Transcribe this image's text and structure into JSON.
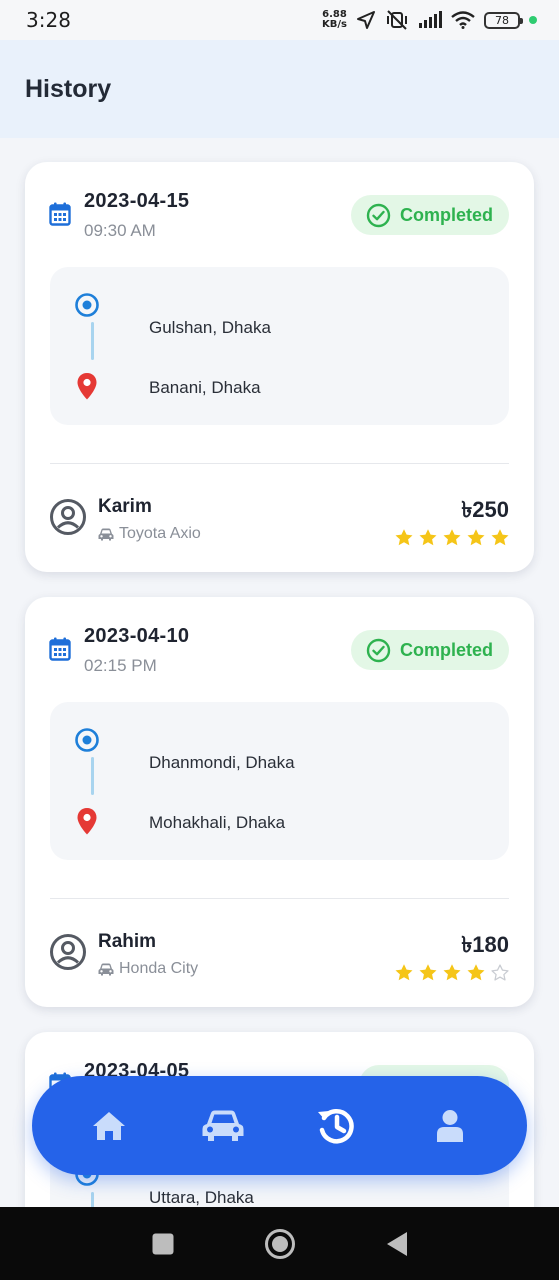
{
  "status_bar": {
    "time": "3:28",
    "net_speed_value": "6.88",
    "net_speed_unit": "KB/s",
    "battery": "78",
    "accent_dot_color": "#2ecc71"
  },
  "header": {
    "title": "History"
  },
  "trips": [
    {
      "date": "2023-04-15",
      "time": "09:30 AM",
      "status": "Completed",
      "origin": "Gulshan, Dhaka",
      "destination": "Banani, Dhaka",
      "driver": "Karim",
      "car": "Toyota Axio",
      "fare": "৳250",
      "rating": 5
    },
    {
      "date": "2023-04-10",
      "time": "02:15 PM",
      "status": "Completed",
      "origin": "Dhanmondi, Dhaka",
      "destination": "Mohakhali, Dhaka",
      "driver": "Rahim",
      "car": "Honda City",
      "fare": "৳180",
      "rating": 4
    },
    {
      "date": "2023-04-05",
      "origin": "Uttara, Dhaka"
    }
  ],
  "bottom_nav": {
    "items": [
      "home-icon",
      "car-icon",
      "history-icon",
      "profile-icon"
    ],
    "active": "history-icon"
  },
  "colors": {
    "primary": "#2563e9",
    "completed": "#2eb24f",
    "star": "#f5c518",
    "destination_pin": "#e53935"
  }
}
